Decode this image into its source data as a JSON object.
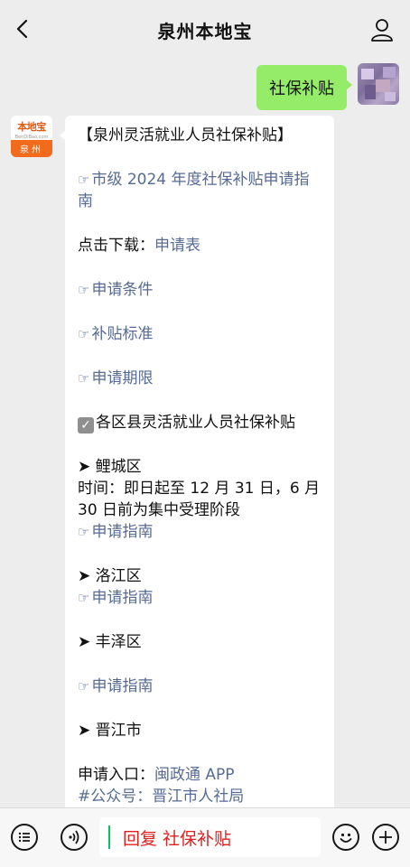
{
  "header": {
    "title": "泉州本地宝"
  },
  "messages": {
    "user": {
      "text": "社保补贴"
    },
    "bot": {
      "avatar_top": "本地宝",
      "avatar_sub": "BenDiBao.com",
      "avatar_bottom": "泉州",
      "heading": "【泉州灵活就业人员社保补贴】",
      "guide_link": "市级 2024 年度社保补贴申请指南",
      "download_label": "点击下载：",
      "download_link": "申请表",
      "conditions_link": "申请条件",
      "standard_link": "补贴标准",
      "period_link": "申请期限",
      "county_heading": "各区县灵活就业人员社保补贴",
      "licheng": "鲤城区",
      "licheng_time": "时间：即日起至 12 月 31 日，6 月 30 日前为集中受理阶段",
      "licheng_link": "申请指南",
      "luojiang": "洛江区",
      "luojiang_link": "申请指南",
      "fengze": "丰泽区",
      "fengze_link": "申请指南",
      "jinjiang": "晋江市",
      "entry_label": "申请入口：",
      "entry_link": "闽政通 APP",
      "wechat_label": "#公众号：",
      "wechat_link": "晋江市人社局"
    }
  },
  "input": {
    "value": "回复 社保补贴"
  },
  "icons": {
    "back": "chevron-left-icon",
    "profile": "person-icon",
    "menu": "list-icon",
    "voice": "voice-icon",
    "emoji": "smile-icon",
    "more": "plus-icon",
    "hand": "pointing-hand-icon",
    "check": "checkbox-icon",
    "arrow": "arrowhead-icon"
  },
  "colors": {
    "link": "#576b95",
    "bubble_self": "#95ec69",
    "caret": "#07c160",
    "input_text": "#e02020"
  }
}
